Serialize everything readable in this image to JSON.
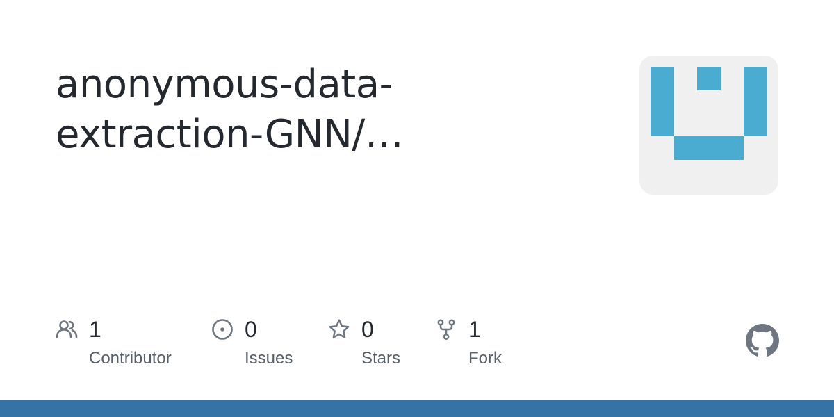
{
  "repo": {
    "title_line1": "anonymous-data-",
    "title_line2": "extraction-GNN/…"
  },
  "stats": {
    "contributors": {
      "count": "1",
      "label": "Contributor",
      "icon": "people-icon"
    },
    "issues": {
      "count": "0",
      "label": "Issues",
      "icon": "issue-opened-icon"
    },
    "stars": {
      "count": "0",
      "label": "Stars",
      "icon": "star-icon"
    },
    "forks": {
      "count": "1",
      "label": "Fork",
      "icon": "repo-forked-icon"
    }
  },
  "colors": {
    "text": "#24292f",
    "muted": "#57606a",
    "avatar_bg": "#f0f0f0",
    "avatar_fg": "#4bacd1",
    "bar": "#3572a5",
    "github_mark": "#6e7781"
  }
}
